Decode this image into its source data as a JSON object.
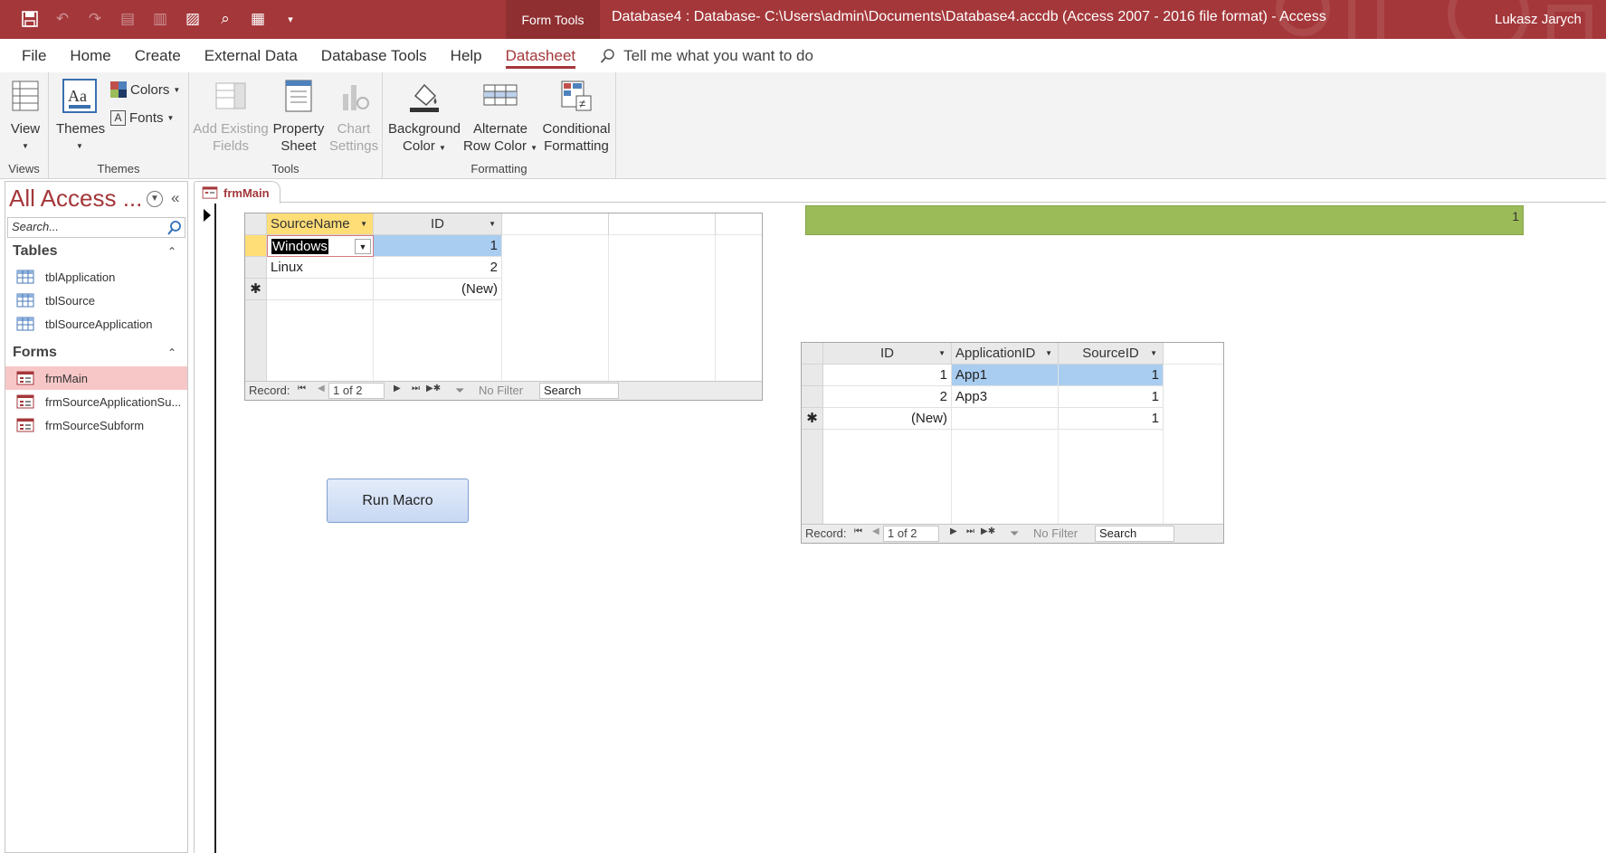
{
  "titlebar": {
    "context_tab": "Form Tools",
    "doc_title": "Database4 : Database- C:\\Users\\admin\\Documents\\Database4.accdb (Access 2007 - 2016 file format)  -  Access",
    "user": "Lukasz Jarych"
  },
  "tabs": {
    "items": [
      "File",
      "Home",
      "Create",
      "External Data",
      "Database Tools",
      "Help",
      "Datasheet"
    ],
    "active": "Datasheet",
    "tellme": "Tell me what you want to do"
  },
  "ribbon": {
    "views": {
      "view": "View",
      "label": "Views"
    },
    "themes": {
      "themes": "Themes",
      "colors": "Colors",
      "fonts": "Fonts",
      "label": "Themes"
    },
    "tools": {
      "add_fields_1": "Add Existing",
      "add_fields_2": "Fields",
      "property_1": "Property",
      "property_2": "Sheet",
      "chart_1": "Chart",
      "chart_2": "Settings",
      "label": "Tools"
    },
    "formatting": {
      "bg_1": "Background",
      "bg_2": "Color",
      "alt_1": "Alternate",
      "alt_2": "Row Color",
      "cond_1": "Conditional",
      "cond_2": "Formatting",
      "label": "Formatting"
    }
  },
  "nav": {
    "header": "All Access ...",
    "search_placeholder": "Search...",
    "sections": [
      {
        "title": "Tables",
        "items": [
          "tblApplication",
          "tblSource",
          "tblSourceApplication"
        ]
      },
      {
        "title": "Forms",
        "items": [
          "frmMain",
          "frmSourceApplicationSu...",
          "frmSourceSubform"
        ]
      }
    ],
    "selected": "frmMain"
  },
  "document": {
    "tab": "frmMain"
  },
  "subform_source": {
    "columns": [
      "SourceName",
      "ID"
    ],
    "rows": [
      {
        "SourceName": "Windows",
        "ID": "1"
      },
      {
        "SourceName": "Linux",
        "ID": "2"
      },
      {
        "SourceName": "",
        "ID": "(New)"
      }
    ],
    "nav": {
      "record_label": "Record:",
      "position": "1 of 2",
      "filter": "No Filter",
      "search": "Search"
    }
  },
  "subform_app": {
    "columns": [
      "ID",
      "ApplicationID",
      "SourceID"
    ],
    "rows": [
      {
        "ID": "1",
        "ApplicationID": "App1",
        "SourceID": "1"
      },
      {
        "ID": "2",
        "ApplicationID": "App3",
        "SourceID": "1"
      },
      {
        "ID": "(New)",
        "ApplicationID": "",
        "SourceID": "1"
      }
    ],
    "nav": {
      "record_label": "Record:",
      "position": "1 of 2",
      "filter": "No Filter",
      "search": "Search"
    }
  },
  "macro_button": "Run Macro",
  "green_field_value": "1",
  "colors": {
    "accent": "#a4373a",
    "selected_header": "#ffdd77",
    "highlight": "#a9cdf0",
    "green_field": "#9bbb59"
  }
}
